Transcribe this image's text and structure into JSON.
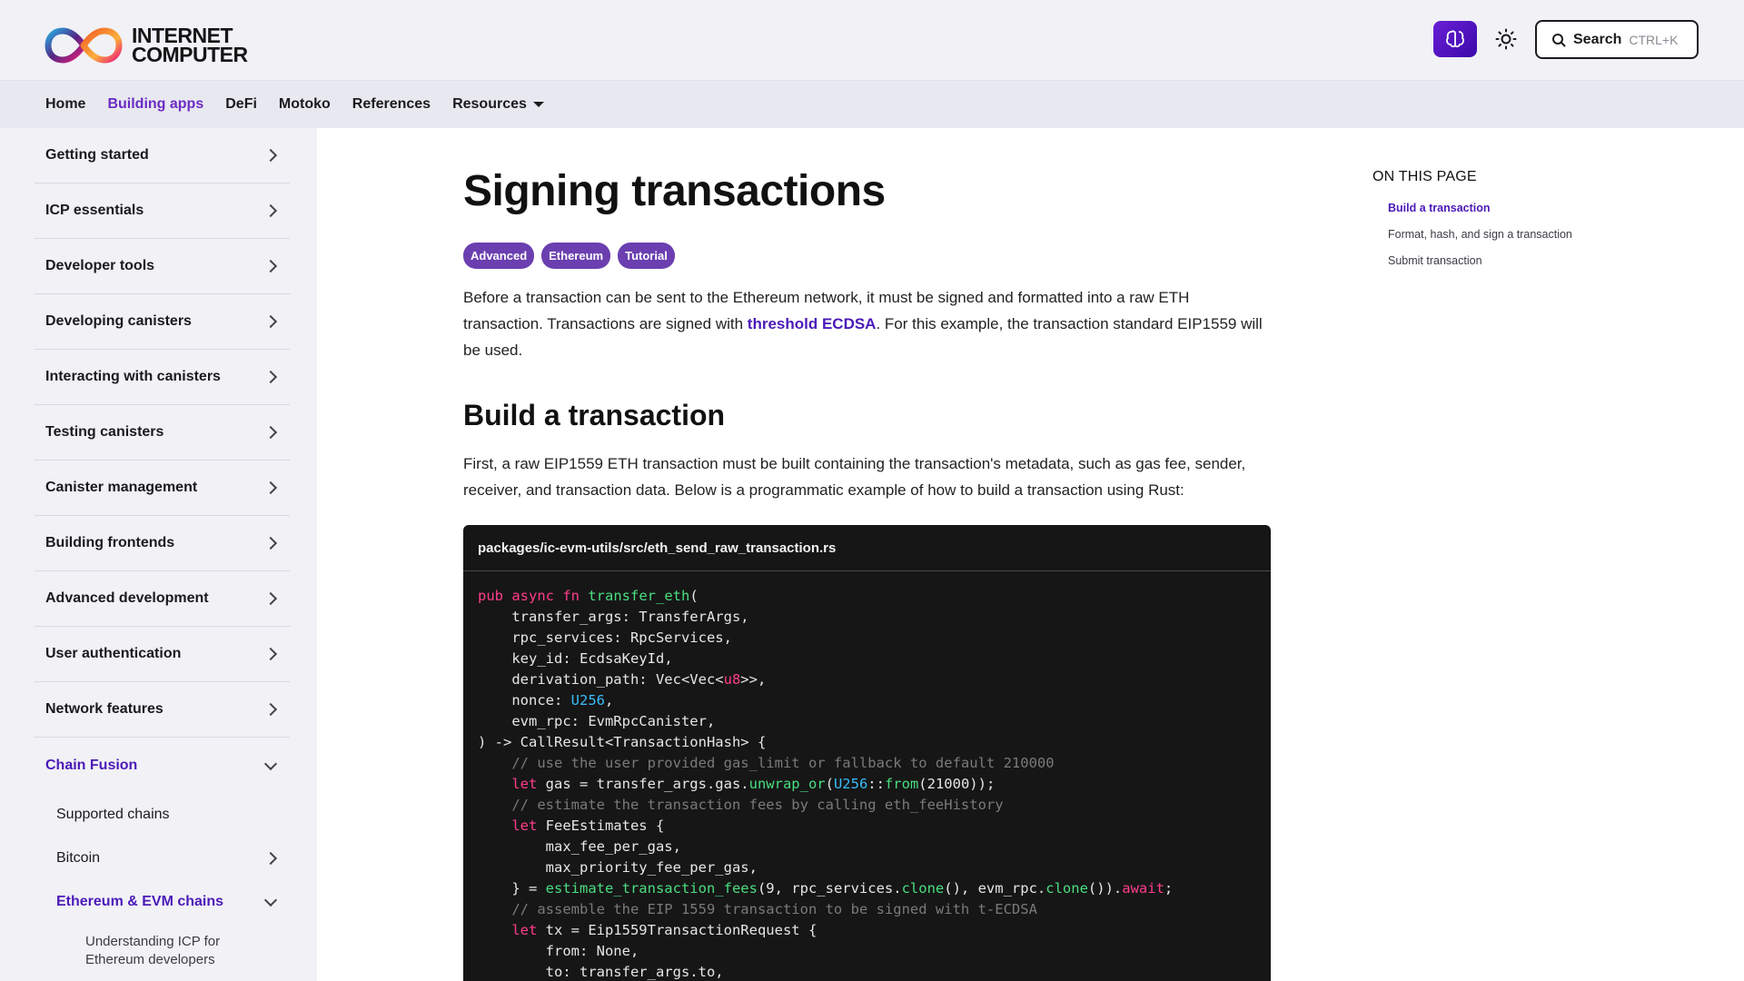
{
  "header": {
    "logo_line1": "INTERNET",
    "logo_line2": "COMPUTER",
    "search_label": "Search",
    "search_shortcut": "CTRL+K",
    "icons": {
      "ai": "ai-assistant-icon",
      "theme": "sun-icon",
      "search": "search-icon"
    }
  },
  "nav": {
    "items": [
      {
        "label": "Home"
      },
      {
        "label": "Building apps"
      },
      {
        "label": "DeFi"
      },
      {
        "label": "Motoko"
      },
      {
        "label": "References"
      },
      {
        "label": "Resources"
      }
    ],
    "active_index": 1
  },
  "sidebar": {
    "items": [
      {
        "label": "Getting started"
      },
      {
        "label": "ICP essentials"
      },
      {
        "label": "Developer tools"
      },
      {
        "label": "Developing canisters"
      },
      {
        "label": "Interacting with canisters"
      },
      {
        "label": "Testing canisters"
      },
      {
        "label": "Canister management"
      },
      {
        "label": "Building frontends"
      },
      {
        "label": "Advanced development"
      },
      {
        "label": "User authentication"
      },
      {
        "label": "Network features"
      },
      {
        "label": "Chain Fusion"
      }
    ],
    "sub_items": [
      {
        "label": "Supported chains"
      },
      {
        "label": "Bitcoin"
      },
      {
        "label": "Ethereum & EVM chains"
      }
    ],
    "subsub_item": "Understanding ICP for Ethereum developers"
  },
  "main": {
    "title": "Signing transactions",
    "tags": [
      "Advanced",
      "Ethereum",
      "Tutorial"
    ],
    "intro_part1": "Before a transaction can be sent to the Ethereum network, it must be signed and formatted into a raw ETH transaction. Transactions are signed with ",
    "intro_link": "threshold ECDSA",
    "intro_part2": ". For this example, the transaction standard EIP1559 will be used.",
    "section_title": "Build a transaction",
    "section_text": "First, a raw EIP1559 ETH transaction must be built containing the transaction's metadata, such as gas fee, sender, receiver, and transaction data. Below is a programmatic example of how to build a transaction using Rust:",
    "code_filename": "packages/ic-evm-utils/src/eth_send_raw_transaction.rs"
  },
  "toc": {
    "title": "ON THIS PAGE",
    "items": [
      "Build a transaction",
      "Format, hash, and sign a transaction",
      "Submit transaction"
    ]
  },
  "code": [
    [
      [
        "kw",
        "pub async fn "
      ],
      [
        "fn",
        "transfer_eth"
      ],
      [
        "pl",
        "("
      ]
    ],
    [
      [
        "pl",
        "    transfer_args: TransferArgs,"
      ]
    ],
    [
      [
        "pl",
        "    rpc_services: RpcServices,"
      ]
    ],
    [
      [
        "pl",
        "    key_id: EcdsaKeyId,"
      ]
    ],
    [
      [
        "pl",
        "    derivation_path: Vec<Vec<"
      ],
      [
        "kw",
        "u8"
      ],
      [
        "pl",
        ">>,"
      ]
    ],
    [
      [
        "pl",
        "    nonce: "
      ],
      [
        "ty",
        "U256"
      ],
      [
        "pl",
        ","
      ]
    ],
    [
      [
        "pl",
        "    evm_rpc: EvmRpcCanister,"
      ]
    ],
    [
      [
        "pl",
        ") -> CallResult<TransactionHash> {"
      ]
    ],
    [
      [
        "cm",
        "    // use the user provided gas_limit or fallback to default 210000"
      ]
    ],
    [
      [
        "kw",
        "    let "
      ],
      [
        "pl",
        "gas = transfer_args.gas."
      ],
      [
        "fn",
        "unwrap_or"
      ],
      [
        "pl",
        "("
      ],
      [
        "ty",
        "U256"
      ],
      [
        "pl",
        "::"
      ],
      [
        "fn",
        "from"
      ],
      [
        "pl",
        "(21000));"
      ]
    ],
    [
      [
        "cm",
        "    // estimate the transaction fees by calling eth_feeHistory"
      ]
    ],
    [
      [
        "kw",
        "    let "
      ],
      [
        "pl",
        "FeeEstimates {"
      ]
    ],
    [
      [
        "pl",
        "        max_fee_per_gas,"
      ]
    ],
    [
      [
        "pl",
        "        max_priority_fee_per_gas,"
      ]
    ],
    [
      [
        "pl",
        "    } = "
      ],
      [
        "fn",
        "estimate_transaction_fees"
      ],
      [
        "pl",
        "(9, rpc_services."
      ],
      [
        "fn",
        "clone"
      ],
      [
        "pl",
        "(), evm_rpc."
      ],
      [
        "fn",
        "clone"
      ],
      [
        "pl",
        "())."
      ],
      [
        "kw",
        "await"
      ],
      [
        "pl",
        ";"
      ]
    ],
    [
      [
        "cm",
        "    // assemble the EIP 1559 transaction to be signed with t-ECDSA"
      ]
    ],
    [
      [
        "kw",
        "    let "
      ],
      [
        "pl",
        "tx = Eip1559TransactionRequest {"
      ]
    ],
    [
      [
        "pl",
        "        from: None,"
      ]
    ],
    [
      [
        "pl",
        "        to: transfer_args.to,"
      ]
    ]
  ]
}
